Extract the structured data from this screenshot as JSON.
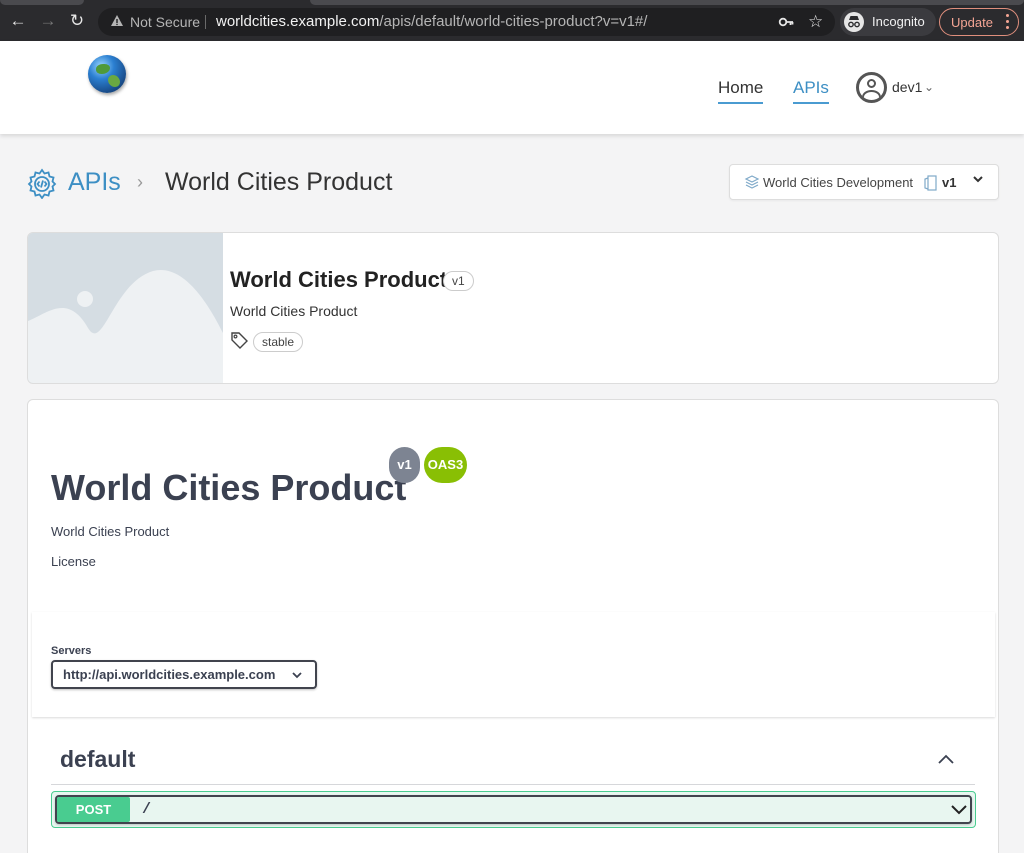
{
  "browser": {
    "not_secure": "Not Secure",
    "url_host": "worldcities.example.com",
    "url_path": "/apis/default/world-cities-product?v=v1#/",
    "incognito_label": "Incognito",
    "update_label": "Update",
    "back_icon": "back-arrow-icon",
    "forward_icon": "forward-arrow-icon",
    "reload_icon": "reload-icon"
  },
  "header": {
    "logo_icon": "globe-icon",
    "nav": [
      {
        "label": "Home",
        "active": false
      },
      {
        "label": "APIs",
        "active": true
      }
    ],
    "user": "dev1"
  },
  "breadcrumb": {
    "root": "APIs",
    "current": "World Cities Product"
  },
  "environment": {
    "label": "World Cities Development",
    "version": "v1"
  },
  "product": {
    "title": "World Cities Product",
    "version": "v1",
    "description": "World Cities Product",
    "tags": [
      "stable"
    ]
  },
  "swagger": {
    "title": "World Cities Product",
    "version_badge": "v1",
    "spec_badge": "OAS3",
    "description": "World Cities Product",
    "license": "License",
    "servers_label": "Servers",
    "server_selected": "http://api.worldcities.example.com",
    "group": "default",
    "operations": [
      {
        "method": "POST",
        "path": "/"
      }
    ]
  },
  "colors": {
    "accent": "#3d8fc4",
    "post_green": "#49cc90",
    "oas_green": "#89bf04",
    "version_gray": "#7d8492"
  }
}
